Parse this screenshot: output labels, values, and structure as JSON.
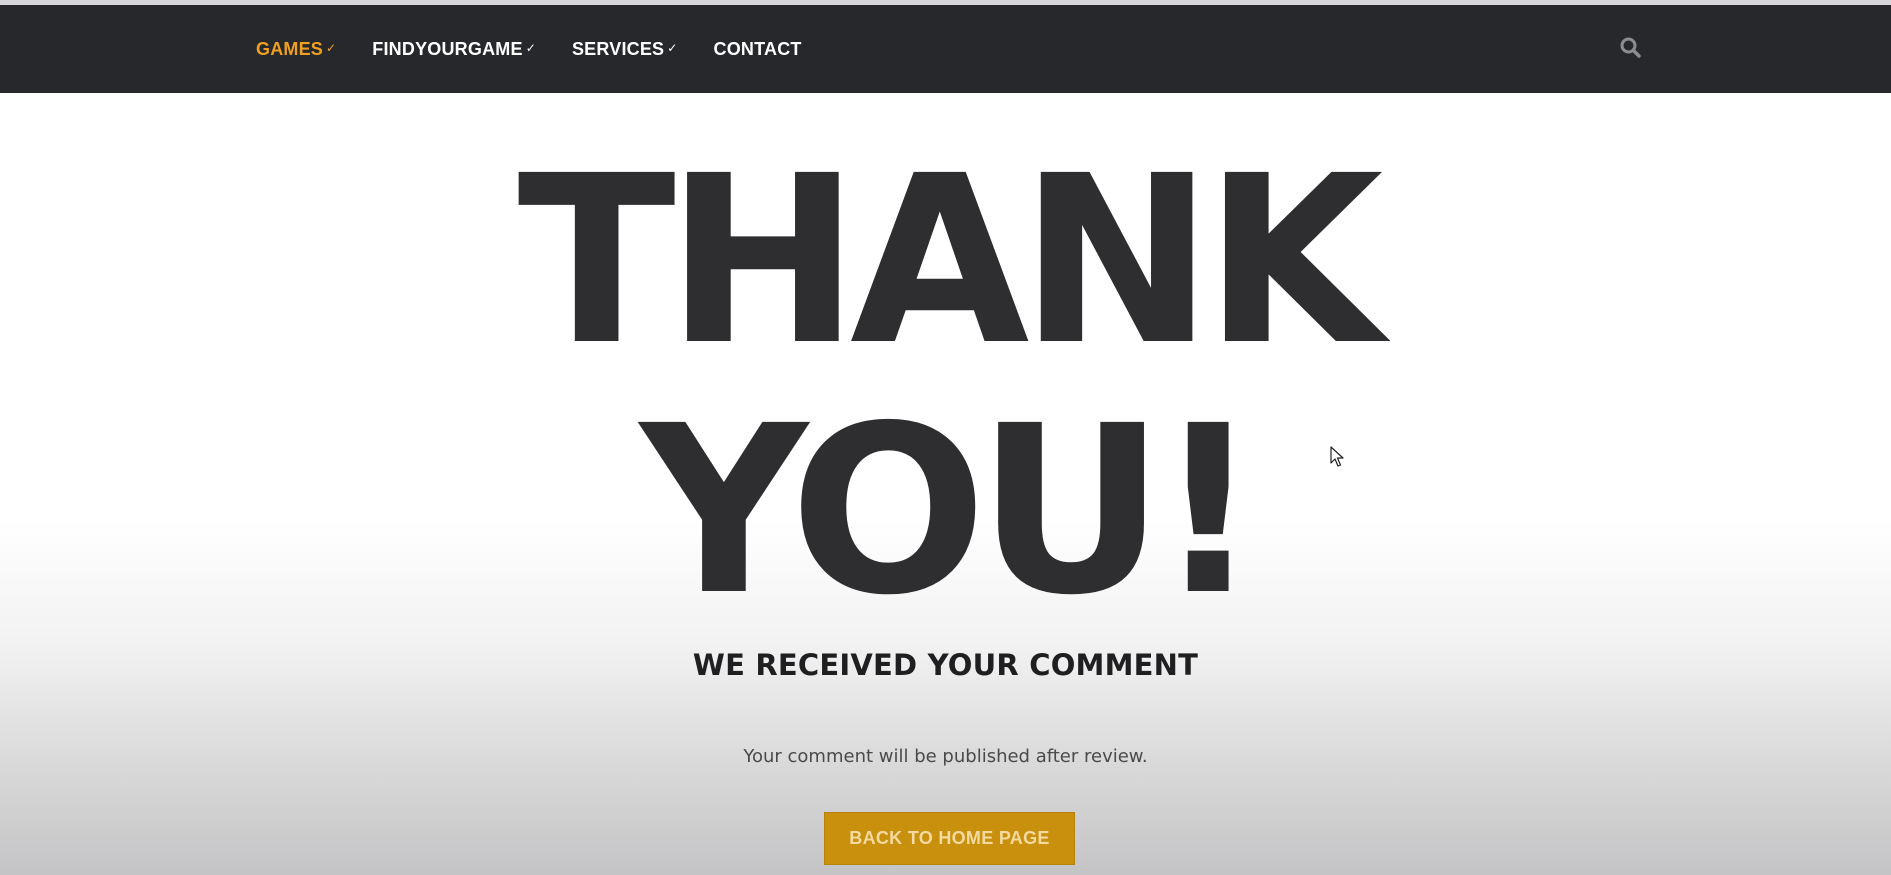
{
  "nav": {
    "items": [
      {
        "label": "GAMES",
        "active": true
      },
      {
        "label": "FINDYOURGAME",
        "active": false
      },
      {
        "label": "SERVICES",
        "active": false
      },
      {
        "label": "CONTACT",
        "active": false
      }
    ],
    "search_icon": "search-icon"
  },
  "hero": {
    "line1": "THANK",
    "line2": "YOU!",
    "subheading": "WE RECEIVED YOUR COMMENT",
    "message": "Your comment will be published after review."
  },
  "cta": {
    "label": "BACK TO HOME PAGE"
  },
  "colors": {
    "nav_bg": "#26282c",
    "accent": "#f0a020",
    "button": "#c8900c",
    "hero_text": "#2e2e30"
  }
}
